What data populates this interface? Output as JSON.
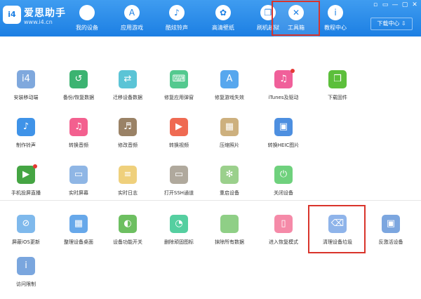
{
  "brand": {
    "logo": "i4",
    "name": "爱思助手",
    "url": "www.i4.cn"
  },
  "nav": [
    {
      "label": "我的设备",
      "icon": "apple-icon",
      "glyph": ""
    },
    {
      "label": "应用游戏",
      "icon": "app-store-icon",
      "glyph": "A"
    },
    {
      "label": "酷炫铃声",
      "icon": "bell-icon",
      "glyph": "♪"
    },
    {
      "label": "高清壁纸",
      "icon": "flower-icon",
      "glyph": "✿"
    },
    {
      "label": "刷机越狱",
      "icon": "box-icon",
      "glyph": "❒"
    },
    {
      "label": "工具箱",
      "icon": "tools-icon",
      "glyph": "✕"
    },
    {
      "label": "教程中心",
      "icon": "info-icon",
      "glyph": "i"
    }
  ],
  "download_center": "下载中心 ⇩",
  "window_controls": [
    "▫",
    "▭",
    "—",
    "▢",
    "✕"
  ],
  "tools": [
    {
      "label": "安装移动端",
      "icon": "i4-mobile-icon",
      "glyph": "i4",
      "color": "#7fa8dd"
    },
    {
      "label": "备份/恢复数据",
      "icon": "backup-icon",
      "glyph": "↺",
      "color": "#3cb371"
    },
    {
      "label": "迁移设备数据",
      "icon": "migrate-icon",
      "glyph": "⇄",
      "color": "#5bc4d6"
    },
    {
      "label": "修复应用弹窗",
      "icon": "keyboard-icon",
      "glyph": "⌨",
      "color": "#54c98f"
    },
    {
      "label": "修复游戏失效",
      "icon": "app-store-icon",
      "glyph": "A",
      "color": "#57a7ee"
    },
    {
      "label": "iTunes及驱动",
      "icon": "itunes-icon",
      "glyph": "♫",
      "color": "#f0609a",
      "badge": true
    },
    {
      "label": "下载固件",
      "icon": "box-icon",
      "glyph": "❒",
      "color": "#5cbf3b"
    },
    {
      "label": "制作铃声",
      "icon": "bell-icon",
      "glyph": "♪",
      "color": "#3f93e8"
    },
    {
      "label": "转换音频",
      "icon": "music-icon",
      "glyph": "♫",
      "color": "#f3608f"
    },
    {
      "label": "修改音频",
      "icon": "audio-edit-icon",
      "glyph": "♬",
      "color": "#9a8266"
    },
    {
      "label": "转换视频",
      "icon": "video-icon",
      "glyph": "▶",
      "color": "#ef6a52"
    },
    {
      "label": "压缩照片",
      "icon": "photo-icon",
      "glyph": "▦",
      "color": "#cdb07e"
    },
    {
      "label": "转换HEIC图片",
      "icon": "heic-icon",
      "glyph": "▣",
      "color": "#4d8fe0"
    },
    {
      "label": "手机投屏直播",
      "icon": "screen-mirror-icon",
      "glyph": "▶",
      "color": "#45a543",
      "badge": true
    },
    {
      "label": "实时屏幕",
      "icon": "monitor-icon",
      "glyph": "▭",
      "color": "#8fb6e5"
    },
    {
      "label": "实时日志",
      "icon": "log-icon",
      "glyph": "≡",
      "color": "#efd07c"
    },
    {
      "label": "打开SSH通道",
      "icon": "ssh-icon",
      "glyph": "▭",
      "color": "#b0a99d"
    },
    {
      "label": "重启设备",
      "icon": "restart-icon",
      "glyph": "✻",
      "color": "#9bd08c"
    },
    {
      "label": "关闭设备",
      "icon": "power-icon",
      "glyph": "⏻",
      "color": "#6fd17d"
    },
    {
      "label": "屏蔽iOS更新",
      "icon": "block-update-icon",
      "glyph": "⊘",
      "color": "#7fb9ec"
    },
    {
      "label": "整理设备桌面",
      "icon": "grid-icon",
      "glyph": "▦",
      "color": "#67a8ea"
    },
    {
      "label": "设备功能开关",
      "icon": "toggle-icon",
      "glyph": "◐",
      "color": "#6dbf61"
    },
    {
      "label": "删除顽固图标",
      "icon": "delete-icon-icon",
      "glyph": "◔",
      "color": "#55cfa0"
    },
    {
      "label": "抹除所有数据",
      "icon": "erase-icon",
      "glyph": "",
      "color": "#8fcf86"
    },
    {
      "label": "进入恢复模式",
      "icon": "recovery-icon",
      "glyph": "▯",
      "color": "#f58aa8"
    },
    {
      "label": "清理设备垃圾",
      "icon": "broom-icon",
      "glyph": "⌫",
      "color": "#8fb4ea"
    },
    {
      "label": "反激活设备",
      "icon": "deactivate-icon",
      "glyph": "▣",
      "color": "#7ca6df"
    },
    {
      "label": "访问限制",
      "icon": "restriction-icon",
      "glyph": "i",
      "color": "#7aa6de"
    }
  ]
}
